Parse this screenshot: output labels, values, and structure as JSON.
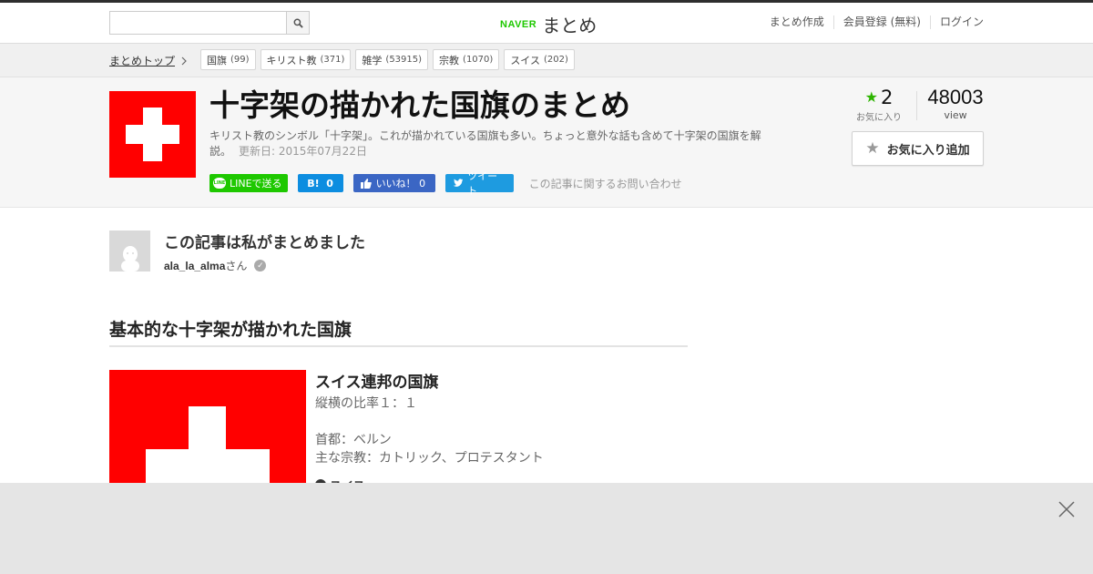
{
  "header": {
    "logo_brand": "NAVER",
    "logo_text": "まとめ",
    "search": {
      "value": "",
      "placeholder": ""
    },
    "nav": [
      "まとめ作成",
      "会員登録 (無料)",
      "ログイン"
    ]
  },
  "breadcrumb": {
    "top_label": "まとめトップ",
    "tags": [
      {
        "label": "国旗",
        "count": "(99)"
      },
      {
        "label": "キリスト教",
        "count": "(371)"
      },
      {
        "label": "雑学",
        "count": "(53915)"
      },
      {
        "label": "宗教",
        "count": "(1070)"
      },
      {
        "label": "スイス",
        "count": "(202)"
      }
    ]
  },
  "article": {
    "title": "十字架の描かれた国旗のまとめ",
    "description": "キリスト教のシンボル「十字架」。これが描かれている国旗も多い。ちょっと意外な話も含めて十字架の国旗を解説。",
    "updated": "更新日: 2015年07月22日",
    "favorites": {
      "count": "2",
      "label": "お気に入り"
    },
    "views": {
      "count": "48003",
      "label": "view"
    },
    "fav_button_label": "お気に入り追加",
    "share": {
      "line": "LINEで送る",
      "hatena_mark": "B!",
      "hatena_count": "0",
      "facebook": "いいね！",
      "facebook_count": "0",
      "tweet": "ツイート",
      "contact": "この記事に関するお問い合わせ"
    },
    "colors": {
      "flag_red": "#ff0000",
      "brand_green": "#1ec800"
    }
  },
  "author": {
    "heading": "この記事は私がまとめました",
    "name": "ala_la_alma",
    "suffix": "さん"
  },
  "section": {
    "heading": "基本的な十字架が描かれた国旗",
    "item": {
      "title": "スイス連邦の国旗",
      "ratio": "縦横の比率１：１",
      "capital": "首都：ベルン",
      "religion": "主な宗教：カトリック、プロテスタント",
      "location": "スイス"
    }
  },
  "overlay": {
    "close_icon": "close-icon"
  }
}
